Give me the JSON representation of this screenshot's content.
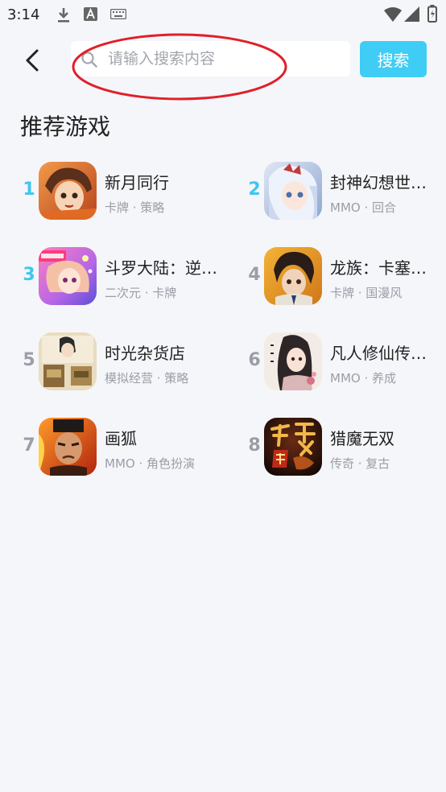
{
  "status_bar": {
    "time": "3:14"
  },
  "search": {
    "placeholder": "请输入搜索内容",
    "button_label": "搜索"
  },
  "section_title": "推荐游戏",
  "games": [
    {
      "rank": "1",
      "name": "新月同行",
      "tags": "卡牌 · 策略",
      "icon": "game-art-xinyue"
    },
    {
      "rank": "2",
      "name": "封神幻想世…",
      "tags": "MMO · 回合",
      "icon": "game-art-fengshen"
    },
    {
      "rank": "3",
      "name": "斗罗大陆：逆…",
      "tags": "二次元 · 卡牌",
      "icon": "game-art-douluo"
    },
    {
      "rank": "4",
      "name": "龙族：卡塞…",
      "tags": "卡牌 · 国漫风",
      "icon": "game-art-longzu"
    },
    {
      "rank": "5",
      "name": "时光杂货店",
      "tags": "模拟经营 · 策略",
      "icon": "game-art-shiguang"
    },
    {
      "rank": "6",
      "name": "凡人修仙传…",
      "tags": "MMO · 养成",
      "icon": "game-art-fanren"
    },
    {
      "rank": "7",
      "name": "画狐",
      "tags": "MMO · 角色扮演",
      "icon": "game-art-huahu"
    },
    {
      "rank": "8",
      "name": "猎魔无双",
      "tags": "传奇 · 复古",
      "icon": "game-art-liemo"
    }
  ],
  "colors": {
    "accent": "#3fcdf5",
    "rank_top": "#3fc6f0",
    "rank_rest": "#9a9ea6",
    "background": "#f5f6fa",
    "annotation": "#e0202a"
  }
}
